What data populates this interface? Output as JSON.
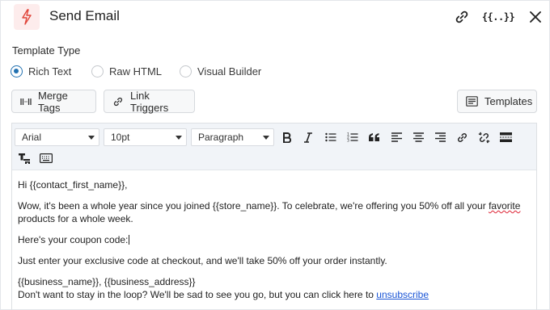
{
  "header": {
    "title": "Send Email",
    "logo_icon": "bolt-icon",
    "accent_color": "#e0453a",
    "actions": [
      {
        "name": "link-icon"
      },
      {
        "name": "merge-tags-icon",
        "glyph": "{{..}}"
      },
      {
        "name": "close-icon"
      }
    ]
  },
  "template_type": {
    "label": "Template Type",
    "options": [
      "Rich Text",
      "Raw HTML",
      "Visual Builder"
    ],
    "selected": "Rich Text"
  },
  "buttons": {
    "merge_tags": "Merge Tags",
    "link_triggers": "Link Triggers",
    "templates": "Templates"
  },
  "toolbar": {
    "font_family": "Arial",
    "font_size": "10pt",
    "block_format": "Paragraph"
  },
  "body": {
    "greeting": "Hi {{contact_first_name}},",
    "line1_before": "Wow, it's been a whole year since you joined {{store_name}}. To celebrate, we're offering you 50% off all your ",
    "line1_misspelled": "favorite",
    "line1_after": " products for a whole week.",
    "coupon": "Here's your coupon code:",
    "instructions": "Just enter your exclusive code at checkout, and we'll take 50% off your order instantly.",
    "signature": "{{business_name}}, {{business_address}}",
    "footer_text": "Don't want to stay in the loop? We'll be sad to see you go, but you can click here to ",
    "unsubscribe": "unsubscribe"
  }
}
